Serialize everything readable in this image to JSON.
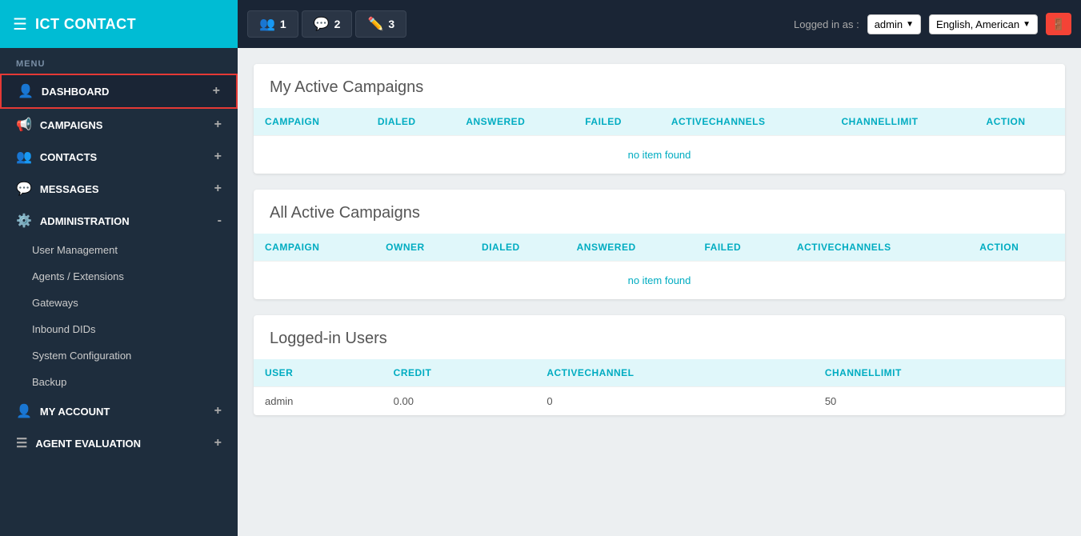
{
  "brand": {
    "name": "ICT CONTACT"
  },
  "topbar": {
    "tabs": [
      {
        "id": "tab1",
        "icon": "👥",
        "count": "1",
        "color_class": "tab-green"
      },
      {
        "id": "tab2",
        "icon": "💬",
        "count": "2",
        "color_class": "tab-teal"
      },
      {
        "id": "tab3",
        "icon": "✏️",
        "count": "3",
        "color_class": "tab-red"
      }
    ],
    "logged_in_label": "Logged in as :",
    "user": "admin",
    "language": "English, American",
    "menu_icon": "☰"
  },
  "sidebar": {
    "menu_label": "MENU",
    "items": [
      {
        "id": "dashboard",
        "label": "DASHBOARD",
        "icon": "👤",
        "suffix": "+",
        "active": true
      },
      {
        "id": "campaigns",
        "label": "CAMPAIGNS",
        "icon": "📢",
        "suffix": "+"
      },
      {
        "id": "contacts",
        "label": "CONTACTS",
        "icon": "👥",
        "suffix": "+"
      },
      {
        "id": "messages",
        "label": "MESSAGES",
        "icon": "💬",
        "suffix": "+"
      },
      {
        "id": "administration",
        "label": "ADMINISTRATION",
        "icon": "⚙️",
        "suffix": "-",
        "expanded": true
      }
    ],
    "sub_items": [
      {
        "id": "user-management",
        "label": "User Management"
      },
      {
        "id": "agents-extensions",
        "label": "Agents / Extensions"
      },
      {
        "id": "gateways",
        "label": "Gateways"
      },
      {
        "id": "inbound-dids",
        "label": "Inbound DIDs"
      },
      {
        "id": "system-configuration",
        "label": "System Configuration"
      },
      {
        "id": "backup",
        "label": "Backup"
      }
    ],
    "bottom_items": [
      {
        "id": "my-account",
        "label": "MY ACCOUNT",
        "icon": "👤",
        "suffix": "+"
      },
      {
        "id": "agent-evaluation",
        "label": "AGENT EVALUATION",
        "icon": "☰",
        "suffix": "+"
      }
    ]
  },
  "main": {
    "my_active_campaigns": {
      "title": "My Active Campaigns",
      "columns": [
        "CAMPAIGN",
        "DIALED",
        "ANSWERED",
        "FAILED",
        "ACTIVECHANNELS",
        "CHANNELLIMIT",
        "ACTION"
      ],
      "no_item_text": "no item found"
    },
    "all_active_campaigns": {
      "title": "All Active Campaigns",
      "columns": [
        "CAMPAIGN",
        "OWNER",
        "DIALED",
        "ANSWERED",
        "FAILED",
        "ACTIVECHANNELS",
        "ACTION"
      ],
      "no_item_text": "no item found"
    },
    "logged_in_users": {
      "title": "Logged-in Users",
      "columns": [
        "USER",
        "CREDIT",
        "ACTIVECHANNEL",
        "CHANNELLIMIT"
      ],
      "rows": [
        {
          "user": "admin",
          "credit": "0.00",
          "activechannel": "0",
          "channellimit": "50"
        }
      ]
    }
  }
}
